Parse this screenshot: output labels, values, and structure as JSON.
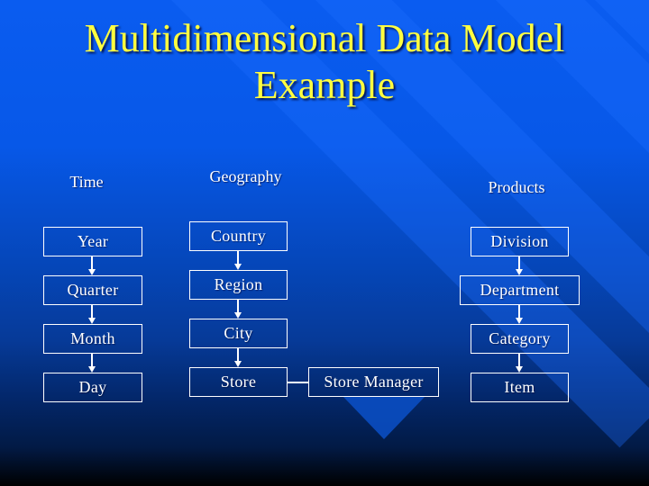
{
  "slide": {
    "title_line1": "Multidimensional Data Model",
    "title_line2": "Example",
    "colors": {
      "title": "#ffff40",
      "text": "#ffffff",
      "background_top": "#0a5cf0",
      "background_bottom": "#000000"
    }
  },
  "dimensions": {
    "time": {
      "label": "Time",
      "levels": [
        "Year",
        "Quarter",
        "Month",
        "Day"
      ]
    },
    "geography": {
      "label": "Geography",
      "levels": [
        "Country",
        "Region",
        "City",
        "Store"
      ],
      "attribute": "Store Manager"
    },
    "products": {
      "label": "Products",
      "levels": [
        "Division",
        "Department",
        "Category",
        "Item"
      ]
    }
  }
}
